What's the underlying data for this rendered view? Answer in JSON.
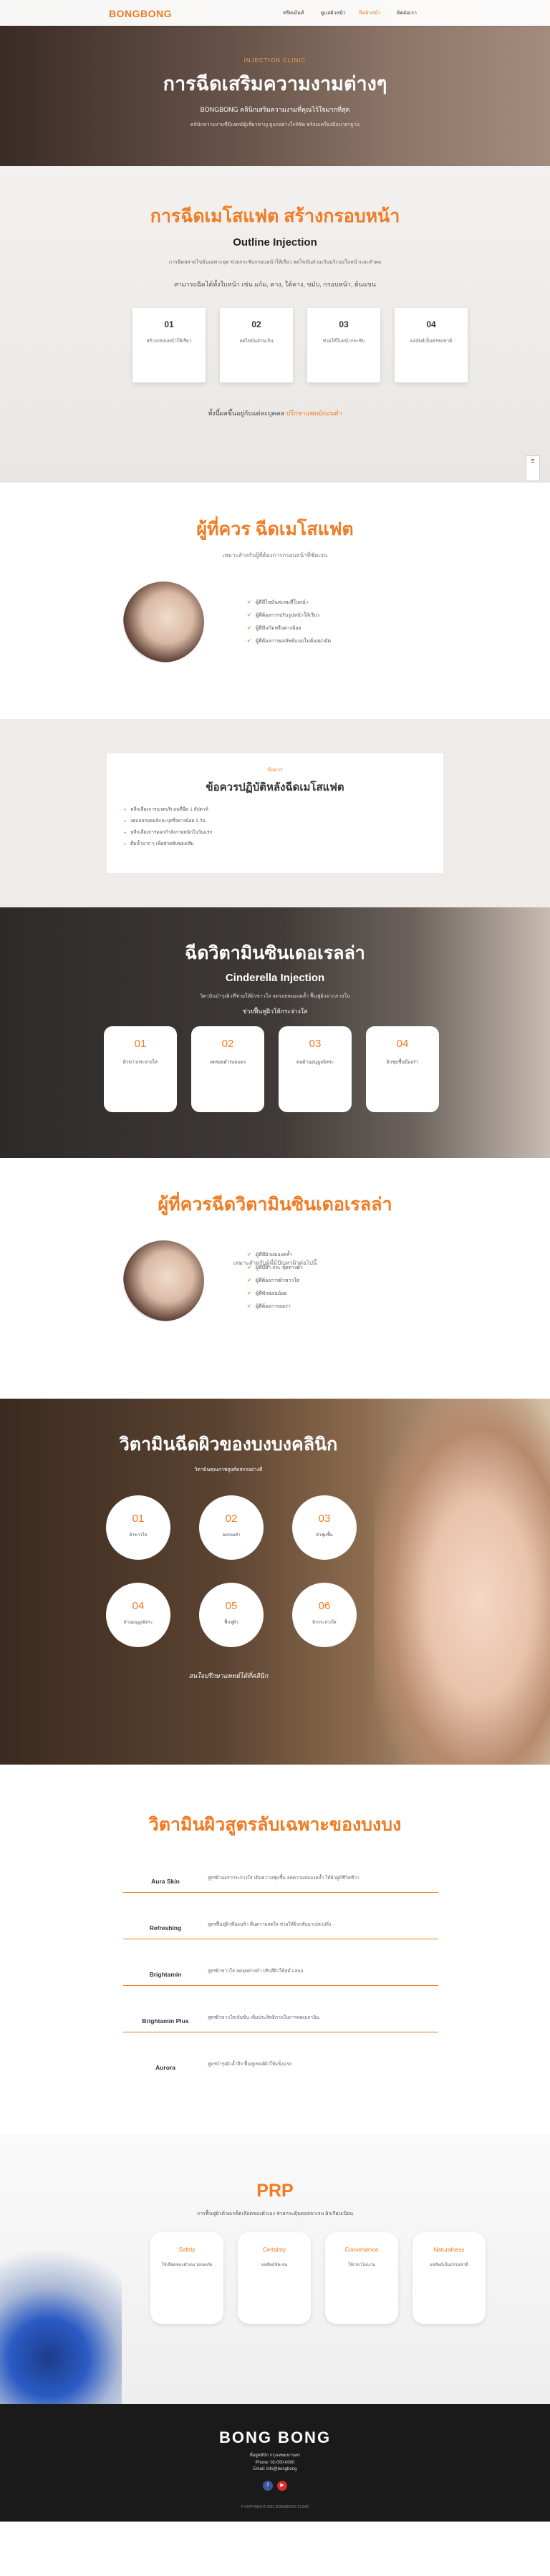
{
  "header": {
    "logo": "BONGBONG",
    "nav": [
      "ทรีทเม้นท์",
      "ดูแลผิวหน้า",
      "ฉีดผิวหน้า",
      "ติดต่อเรา"
    ],
    "active_nav": 2
  },
  "hero": {
    "sub": "INJECTION CLINIC",
    "title": "การฉีดเสริมความงามต่างๆ",
    "tag": "BONGBONG คลินิกเสริมความงามที่คุณไว้ใจมากที่สุด",
    "desc": "คลินิกความงามที่มีแพทย์ผู้เชี่ยวชาญ ดูแลอย่างใกล้ชิด พร้อมเครื่องมือมาตรฐาน"
  },
  "outline": {
    "title": "การฉีดเมโสแฟต สร้างกรอบหน้า",
    "eng": "Outline Injection",
    "para": "การฉีดสลายไขมันเฉพาะจุด ช่วยกระชับกรอบหน้าให้เรียว ลดไขมันส่วนเกินบริเวณใบหน้าและลำคอ",
    "areas": "สามารถฉีดได้ทั้งใบหน้า เช่น แก้ม, คาง, ใต้คาง, ขมับ, กรอบหน้า, ต้นแขน",
    "cards": [
      {
        "n": "01",
        "t": "สร้างกรอบหน้าให้เรียว"
      },
      {
        "n": "02",
        "t": "ลดไขมันส่วนเกิน"
      },
      {
        "n": "03",
        "t": "ช่วยให้ใบหน้ากระชับ"
      },
      {
        "n": "04",
        "t": "ผลลัพธ์เป็นธรรมชาติ"
      }
    ],
    "foot": "ทั้งนี้ผลขึ้นอยู่กับแต่ละบุคคล",
    "foot_hl": "ปรึกษาแพทย์ก่อนทำ"
  },
  "who1": {
    "title": "ผู้ที่ควร ฉีดเมโสแฟต",
    "sub": "เหมาะสำหรับผู้ที่ต้องการกรอบหน้าที่ชัดเจน",
    "items": [
      "ผู้ที่มีไขมันสะสมที่ใบหน้า",
      "ผู้ที่ต้องการปรับรูปหน้าให้เรียว",
      "ผู้ที่มีแก้มหรือคางย้อย",
      "ผู้ที่ต้องการผลลัพธ์แบบไม่ต้องผ่าตัด"
    ]
  },
  "care": {
    "o": "ข้อควร",
    "title": "ข้อควรปฏิบัติหลังฉีดเมโสแฟต",
    "items": [
      "หลีกเลี่ยงการนวดบริเวณที่ฉีด 1 สัปดาห์",
      "งดแอลกอฮอล์และบุหรี่อย่างน้อย 3 วัน",
      "หลีกเลี่ยงการออกกำลังกายหนักในวันแรก",
      "ดื่มน้ำมาก ๆ เพื่อช่วยขับของเสีย"
    ]
  },
  "cinderella": {
    "title": "ฉีดวิตามินซินเดอเรลล่า",
    "eng": "Cinderella Injection",
    "para": "วิตามินบำรุงผิวที่ช่วยให้ผิวขาวใส ลดรอยหมองคล้ำ ฟื้นฟูผิวจากภายใน",
    "q": "ช่วยฟื้นฟูผิวให้กระจ่างใส",
    "cards": [
      {
        "n": "01",
        "t": "ผิวขาวกระจ่างใส"
      },
      {
        "n": "02",
        "t": "ลดรอยดำรอยแดง"
      },
      {
        "n": "03",
        "t": "ต่อต้านอนุมูลอิสระ"
      },
      {
        "n": "04",
        "t": "ผิวชุ่มชื้นมีออร่า"
      }
    ]
  },
  "who2": {
    "title": "ผู้ที่ควรฉีดวิตามินซินเดอเรลล่า",
    "sub": "เหมาะสำหรับผู้ที่มีปัญหาผิวต่อไปนี้",
    "items": [
      "ผู้ที่มีผิวหมองคล้ำ",
      "ผู้ที่มีฝ้า กระ จุดด่างดำ",
      "ผู้ที่ต้องการผิวขาวใส",
      "ผู้ที่พักผ่อนน้อย",
      "ผู้ที่ต้องการออร่า"
    ]
  },
  "vitamin": {
    "title": "วิตามินฉีดผิวของบงบงคลินิก",
    "sub": "วิตามินคุณภาพสูงคัดสรรอย่างดี",
    "items": [
      {
        "n": "01",
        "t": "ผิวขาวใส"
      },
      {
        "n": "02",
        "t": "ลดรอยดำ"
      },
      {
        "n": "03",
        "t": "ผิวชุ่มชื้น"
      },
      {
        "n": "04",
        "t": "ต้านอนุมูลอิสระ"
      },
      {
        "n": "05",
        "t": "ฟื้นฟูผิว"
      },
      {
        "n": "06",
        "t": "ผิวกระจ่างใส"
      }
    ],
    "ask": "สนใจปรึกษาแพทย์ได้ที่คลินิก"
  },
  "formula": {
    "title": "วิตามินผิวสูตรลับเฉพาะของบงบง",
    "rows": [
      {
        "n": "Aura Skin",
        "d": "สูตรผิวออร่ากระจ่างใส เติมความชุ่มชื้น ลดความหมองคล้ำ ให้ผิวดูมีชีวิตชีวา"
      },
      {
        "n": "Refreshing",
        "d": "สูตรฟื้นฟูผิวที่อ่อนล้า คืนความสดใส ช่วยให้ผิวกลับมาเปล่งปลั่ง"
      },
      {
        "n": "Brightamin",
        "d": "สูตรผิวขาวใส ลดจุดด่างดำ ปรับสีผิวให้สม่ำเสมอ"
      },
      {
        "n": "Brightamin Plus",
        "d": "สูตรผิวขาวใสเข้มข้น เพิ่มประสิทธิภาพในการลดเมลานิน"
      },
      {
        "n": "Aurora",
        "d": "สูตรบำรุงผิวล้ำลึก ฟื้นฟูเซลล์ผิวให้แข็งแรง"
      }
    ]
  },
  "prp": {
    "title": "PRP",
    "p": "การฟื้นฟูผิวด้วยเกล็ดเลือดของตัวเอง ช่วยกระตุ้นคอลลาเจน ผิวเรียบเนียน",
    "cards": [
      {
        "t": "Safety",
        "d": "ใช้เลือดของตัวเอง ปลอดภัย"
      },
      {
        "t": "Certainty",
        "d": "ผลลัพธ์ชัดเจน"
      },
      {
        "t": "Convenience",
        "d": "ใช้เวลาไม่นาน"
      },
      {
        "t": "Naturalness",
        "d": "ผลลัพธ์เป็นธรรมชาติ"
      }
    ]
  },
  "footer": {
    "logo": "BONG BONG",
    "addr": "ที่อยู่คลินิก กรุงเทพมหานคร",
    "phone": "Phone: 02-000-0000",
    "email": "Email: info@bongbong",
    "copy": "© COPYRIGHT 2023 BONGBONG CLINIC"
  },
  "colors": {
    "accent": "#f07b22"
  }
}
